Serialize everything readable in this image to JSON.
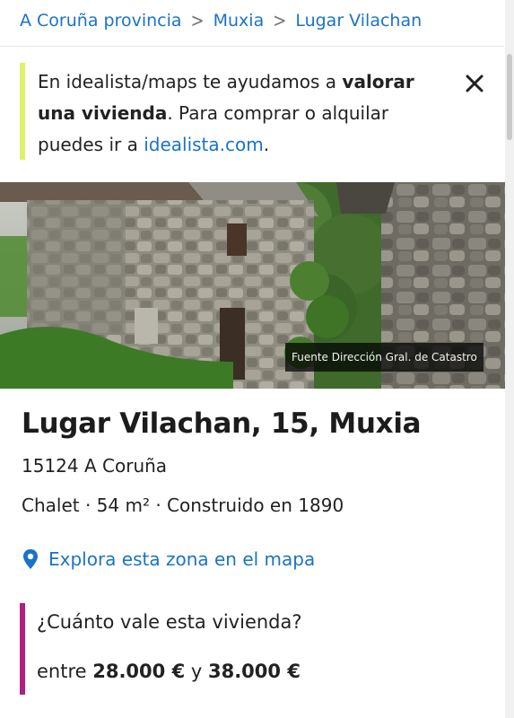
{
  "breadcrumb": {
    "items": [
      {
        "label": "A Coruña provincia"
      },
      {
        "label": "Muxia"
      },
      {
        "label": "Lugar Vilachan"
      }
    ],
    "separator": ">"
  },
  "banner": {
    "text_before": "En idealista/maps te ayudamos a ",
    "bold": "valorar una vivienda",
    "text_middle": ". Para comprar o alquilar puedes ir a ",
    "link": "idealista.com",
    "text_after": ".",
    "accent_color": "#dff06a",
    "close_icon": "close-icon"
  },
  "photo": {
    "credit": "Fuente Dirección Gral. de Catastro"
  },
  "property": {
    "title": "Lugar Vilachan, 15, Muxia",
    "postal": "15124 A Coruña",
    "specs": "Chalet · 54 m² · Construido en 1890"
  },
  "map_link": {
    "label": "Explora esta zona en el mapa",
    "icon": "map-pin-icon"
  },
  "valuation": {
    "question": "¿Cuánto vale esta vivienda?",
    "prefix": "entre ",
    "min": "28.000 €",
    "connector": " y ",
    "max": "38.000 €",
    "accent_color": "#b0207e"
  },
  "colors": {
    "link": "#1a73c9",
    "text": "#222222"
  }
}
